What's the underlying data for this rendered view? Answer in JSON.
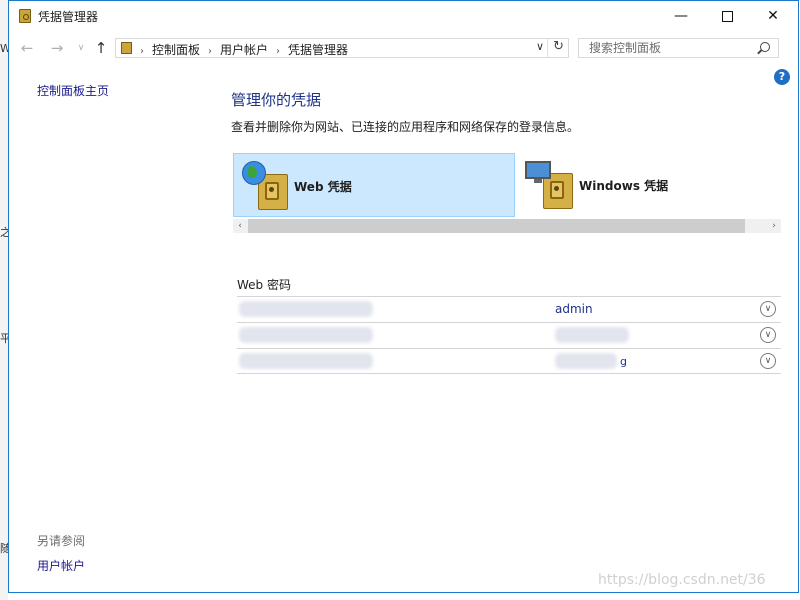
{
  "background_window": {
    "edge_text": [
      "W",
      "之",
      "平",
      "随"
    ]
  },
  "window": {
    "title": "凭据管理器",
    "controls": {
      "minimize": "—",
      "maximize": "",
      "close": "✕"
    }
  },
  "navigation": {
    "back": "←",
    "forward": "→",
    "history": "∨",
    "up": "↑",
    "breadcrumb": [
      "控制面板",
      "用户帐户",
      "凭据管理器"
    ],
    "separator": "›",
    "dropdown": "∨",
    "refresh": "↻",
    "search_placeholder": "搜索控制面板"
  },
  "help": {
    "label": "?"
  },
  "sidebar": {
    "home_link": "控制面板主页",
    "see_also_label": "另请参阅",
    "user_accounts_link": "用户帐户"
  },
  "main": {
    "title": "管理你的凭据",
    "description": "查看并删除你为网站、已连接的应用程序和网络保存的登录信息。",
    "tabs": [
      {
        "label": "Web 凭据",
        "selected": true
      },
      {
        "label": "Windows 凭据",
        "selected": false
      }
    ],
    "scroll_left": "‹",
    "scroll_right": "›"
  },
  "web_passwords": {
    "section_title": "Web 密码",
    "entries": [
      {
        "username": "admin",
        "tail": ""
      },
      {
        "username": "",
        "tail": ""
      },
      {
        "username": "",
        "tail": "g"
      }
    ],
    "expand_glyph": "∨"
  },
  "watermark": "https://blog.csdn.net/36",
  "colors": {
    "selected_tile": "#cce8ff",
    "link": "#1a1a8f",
    "heading": "#1e3287",
    "window_border": "#1979ca"
  }
}
